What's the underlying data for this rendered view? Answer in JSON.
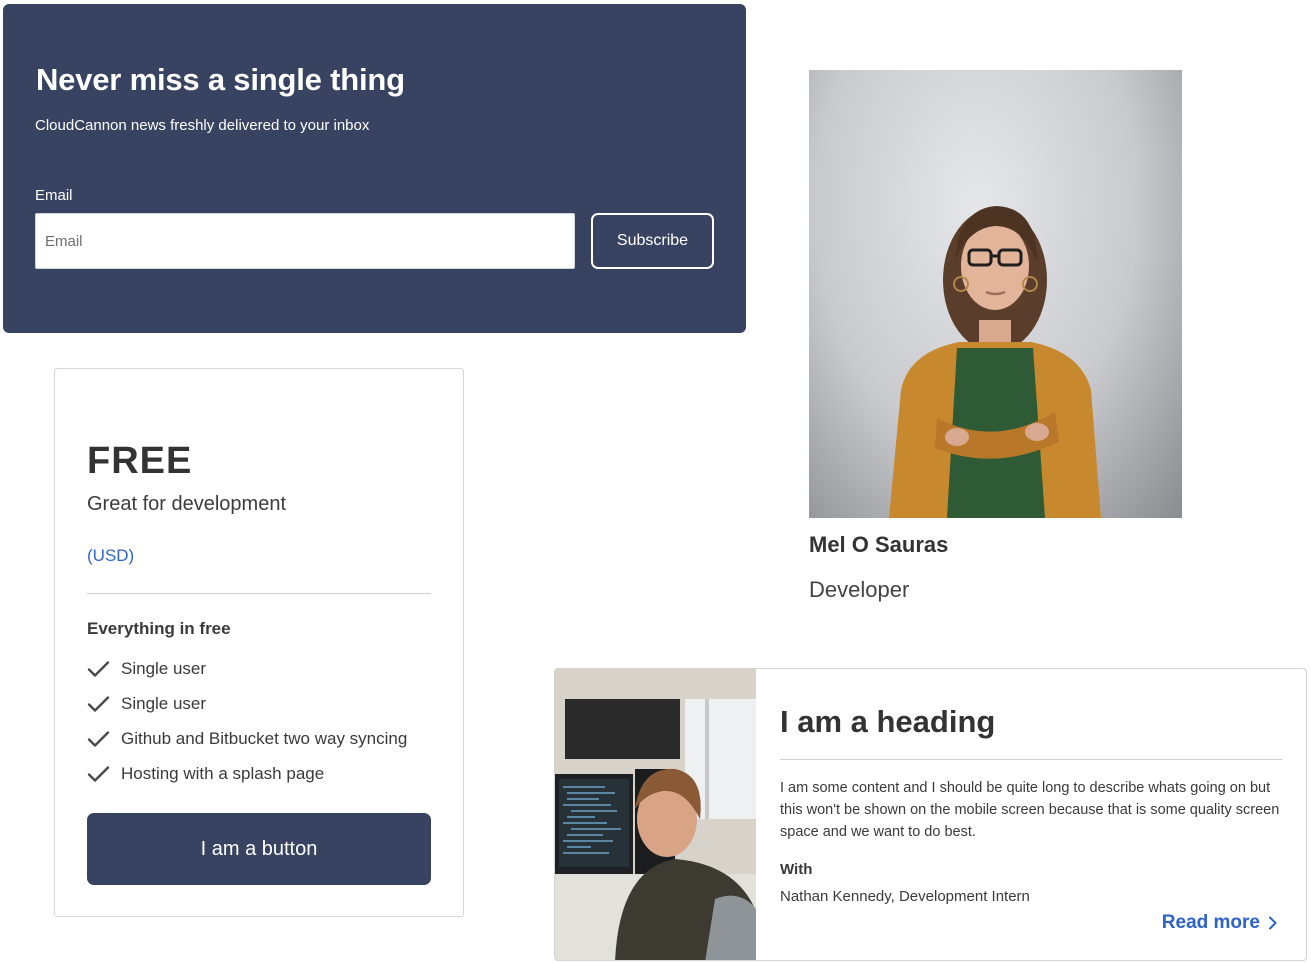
{
  "newsletter": {
    "title": "Never miss a single thing",
    "subtitle": "CloudCannon news freshly delivered to your inbox",
    "email_label": "Email",
    "email_placeholder": "Email",
    "email_value": "",
    "subscribe_label": "Subscribe",
    "background_color": "#374360"
  },
  "pricing": {
    "plan": "FREE",
    "tagline": "Great for development",
    "currency_link": "(USD)",
    "features_title": "Everything in free",
    "features": [
      {
        "label": "Single user",
        "icon": "check-icon"
      },
      {
        "label": "Single user",
        "icon": "check-icon"
      },
      {
        "label": "Github and Bitbucket two way syncing",
        "icon": "check-icon"
      },
      {
        "label": "Hosting with a splash page",
        "icon": "check-icon"
      }
    ],
    "button_label": "I am a button",
    "accent_color": "#374360",
    "link_color": "#2f66c9"
  },
  "profile": {
    "name": "Mel O Sauras",
    "role": "Developer",
    "photo": "portrait-photo"
  },
  "article": {
    "heading": "I am a heading",
    "body": "I am some content and I should be quite long to describe whats going on but this won't be shown on the mobile screen because that is some quality screen space and we want to do best.",
    "with_label": "With",
    "author": "Nathan Kennedy, Development Intern",
    "read_more_label": "Read more",
    "read_more_icon": "chevron-right-icon",
    "link_color": "#2d62c8",
    "thumbnail": "developer-at-desk-photo"
  }
}
